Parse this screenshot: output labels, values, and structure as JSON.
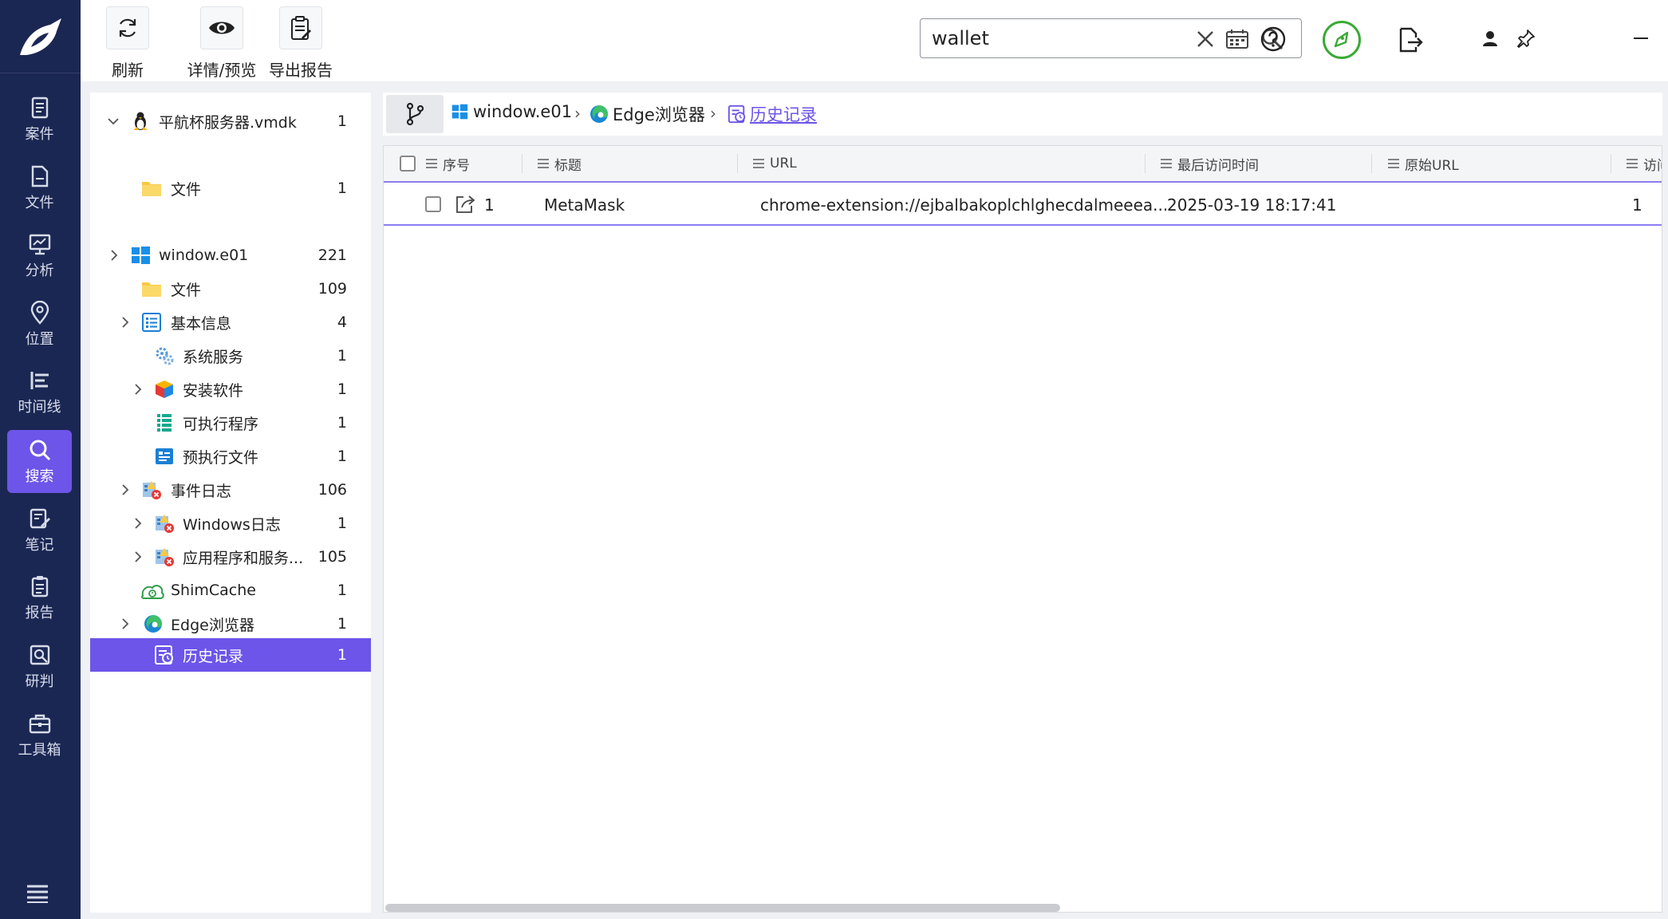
{
  "sidebar": {
    "items": [
      {
        "label": "案件",
        "icon": "case-icon"
      },
      {
        "label": "文件",
        "icon": "file-icon"
      },
      {
        "label": "分析",
        "icon": "analysis-icon"
      },
      {
        "label": "位置",
        "icon": "location-icon"
      },
      {
        "label": "时间线",
        "icon": "timeline-icon"
      },
      {
        "label": "搜索",
        "icon": "search-icon",
        "active": true
      },
      {
        "label": "笔记",
        "icon": "notes-icon"
      },
      {
        "label": "报告",
        "icon": "report-icon"
      },
      {
        "label": "研判",
        "icon": "judge-icon"
      },
      {
        "label": "工具箱",
        "icon": "toolbox-icon"
      }
    ],
    "accent": "#6c55e8",
    "background": "#1b2753"
  },
  "toolbar": {
    "refresh_label": "刷新",
    "preview_label": "详情/预览",
    "export_label": "导出报告",
    "search_value": "wallet"
  },
  "tree": {
    "nodes": [
      {
        "label": "平航杯服务器.vmdk",
        "count": "1",
        "icon": "linux-icon"
      },
      {
        "label": "文件",
        "count": "1",
        "icon": "folder-icon"
      },
      {
        "label": "window.e01",
        "count": "221",
        "icon": "windows-icon"
      },
      {
        "label": "文件",
        "count": "109",
        "icon": "folder-icon"
      },
      {
        "label": "基本信息",
        "count": "4",
        "icon": "basic-info-icon"
      },
      {
        "label": "系统服务",
        "count": "1",
        "icon": "system-service-icon"
      },
      {
        "label": "安装软件",
        "count": "1",
        "icon": "installed-software-icon"
      },
      {
        "label": "可执行程序",
        "count": "1",
        "icon": "executable-icon"
      },
      {
        "label": "预执行文件",
        "count": "1",
        "icon": "prefetch-icon"
      },
      {
        "label": "事件日志",
        "count": "106",
        "icon": "event-log-icon"
      },
      {
        "label": "Windows日志",
        "count": "1",
        "icon": "windows-log-icon"
      },
      {
        "label": "应用程序和服务...",
        "count": "105",
        "icon": "app-service-log-icon"
      },
      {
        "label": "ShimCache",
        "count": "1",
        "icon": "shimcache-icon"
      },
      {
        "label": "Edge浏览器",
        "count": "1",
        "icon": "edge-icon"
      },
      {
        "label": "历史记录",
        "count": "1",
        "icon": "history-icon",
        "selected": true
      }
    ]
  },
  "breadcrumb": {
    "items": [
      {
        "label": "window.e01"
      },
      {
        "label": "Edge浏览器"
      },
      {
        "label": "历史记录"
      }
    ]
  },
  "table": {
    "columns": [
      "序号",
      "标题",
      "URL",
      "最后访问时间",
      "原始URL",
      "访问"
    ],
    "rows": [
      {
        "index": "1",
        "title": "MetaMask",
        "url": "chrome-extension://ejbalbakoplchlghecdalmeeea...",
        "last_visit": "2025-03-19 18:17:41",
        "original_url": "",
        "visits": "1"
      }
    ]
  }
}
